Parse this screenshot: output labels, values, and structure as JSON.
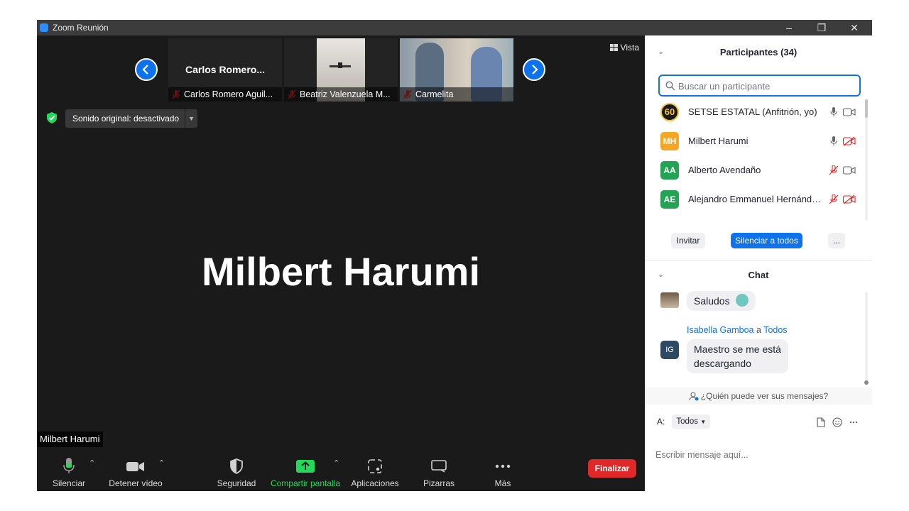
{
  "window": {
    "title": "Zoom Reunión"
  },
  "video": {
    "thumbnails": [
      {
        "name": "Carlos Romero Aguil...",
        "label": "Carlos  Romero..."
      },
      {
        "name": "Beatriz Valenzuela M..."
      },
      {
        "name": "Carmelita"
      }
    ],
    "vista_label": "Vista",
    "sound_label": "Sonido original: desactivado",
    "active_speaker": "Milbert Harumi",
    "name_tag": "Milbert Harumi"
  },
  "toolbar": {
    "mute_label": "Silenciar",
    "video_label": "Detener vídeo",
    "security_label": "Seguridad",
    "share_label": "Compartir pantalla",
    "apps_label": "Aplicaciones",
    "whiteboards_label": "Pizarras",
    "more_label": "Más",
    "end_label": "Finalizar"
  },
  "participants": {
    "header": "Participantes (34)",
    "search_placeholder": "Buscar un participante",
    "list": [
      {
        "initials": "60",
        "name": "SETSE ESTATAL (Anfitrión, yo)",
        "color": "#1a1a1a",
        "mic": "on",
        "video": "on"
      },
      {
        "initials": "MH",
        "name": "Milbert Harumi",
        "color": "#f5a623",
        "mic": "on",
        "video": "off"
      },
      {
        "initials": "AA",
        "name": "Alberto Avendaño",
        "color": "#23a454",
        "mic": "off",
        "video": "on"
      },
      {
        "initials": "AE",
        "name": "Alejandro Emmanuel Hernánde...",
        "color": "#23a454",
        "mic": "off",
        "video": "off"
      }
    ],
    "invite_label": "Invitar",
    "mute_all_label": "Silenciar a todos",
    "more_label": "..."
  },
  "chat": {
    "header": "Chat",
    "messages": [
      {
        "text": "Saludos"
      },
      {
        "sender": "Isabella Gamboa",
        "connector": "a",
        "recipient": "Todos",
        "initials": "IG",
        "text_line1": "Maestro se me está",
        "text_line2": "descargando"
      }
    ],
    "who_can_see": "¿Quién puede ver sus mensajes?",
    "to_label": "A:",
    "to_value": "Todos",
    "input_placeholder": "Escribir mensaje aquí..."
  },
  "colors": {
    "accent": "#0e72ed",
    "end_button": "#e02828",
    "share_green": "#23d959",
    "mute_red": "#e02828"
  }
}
